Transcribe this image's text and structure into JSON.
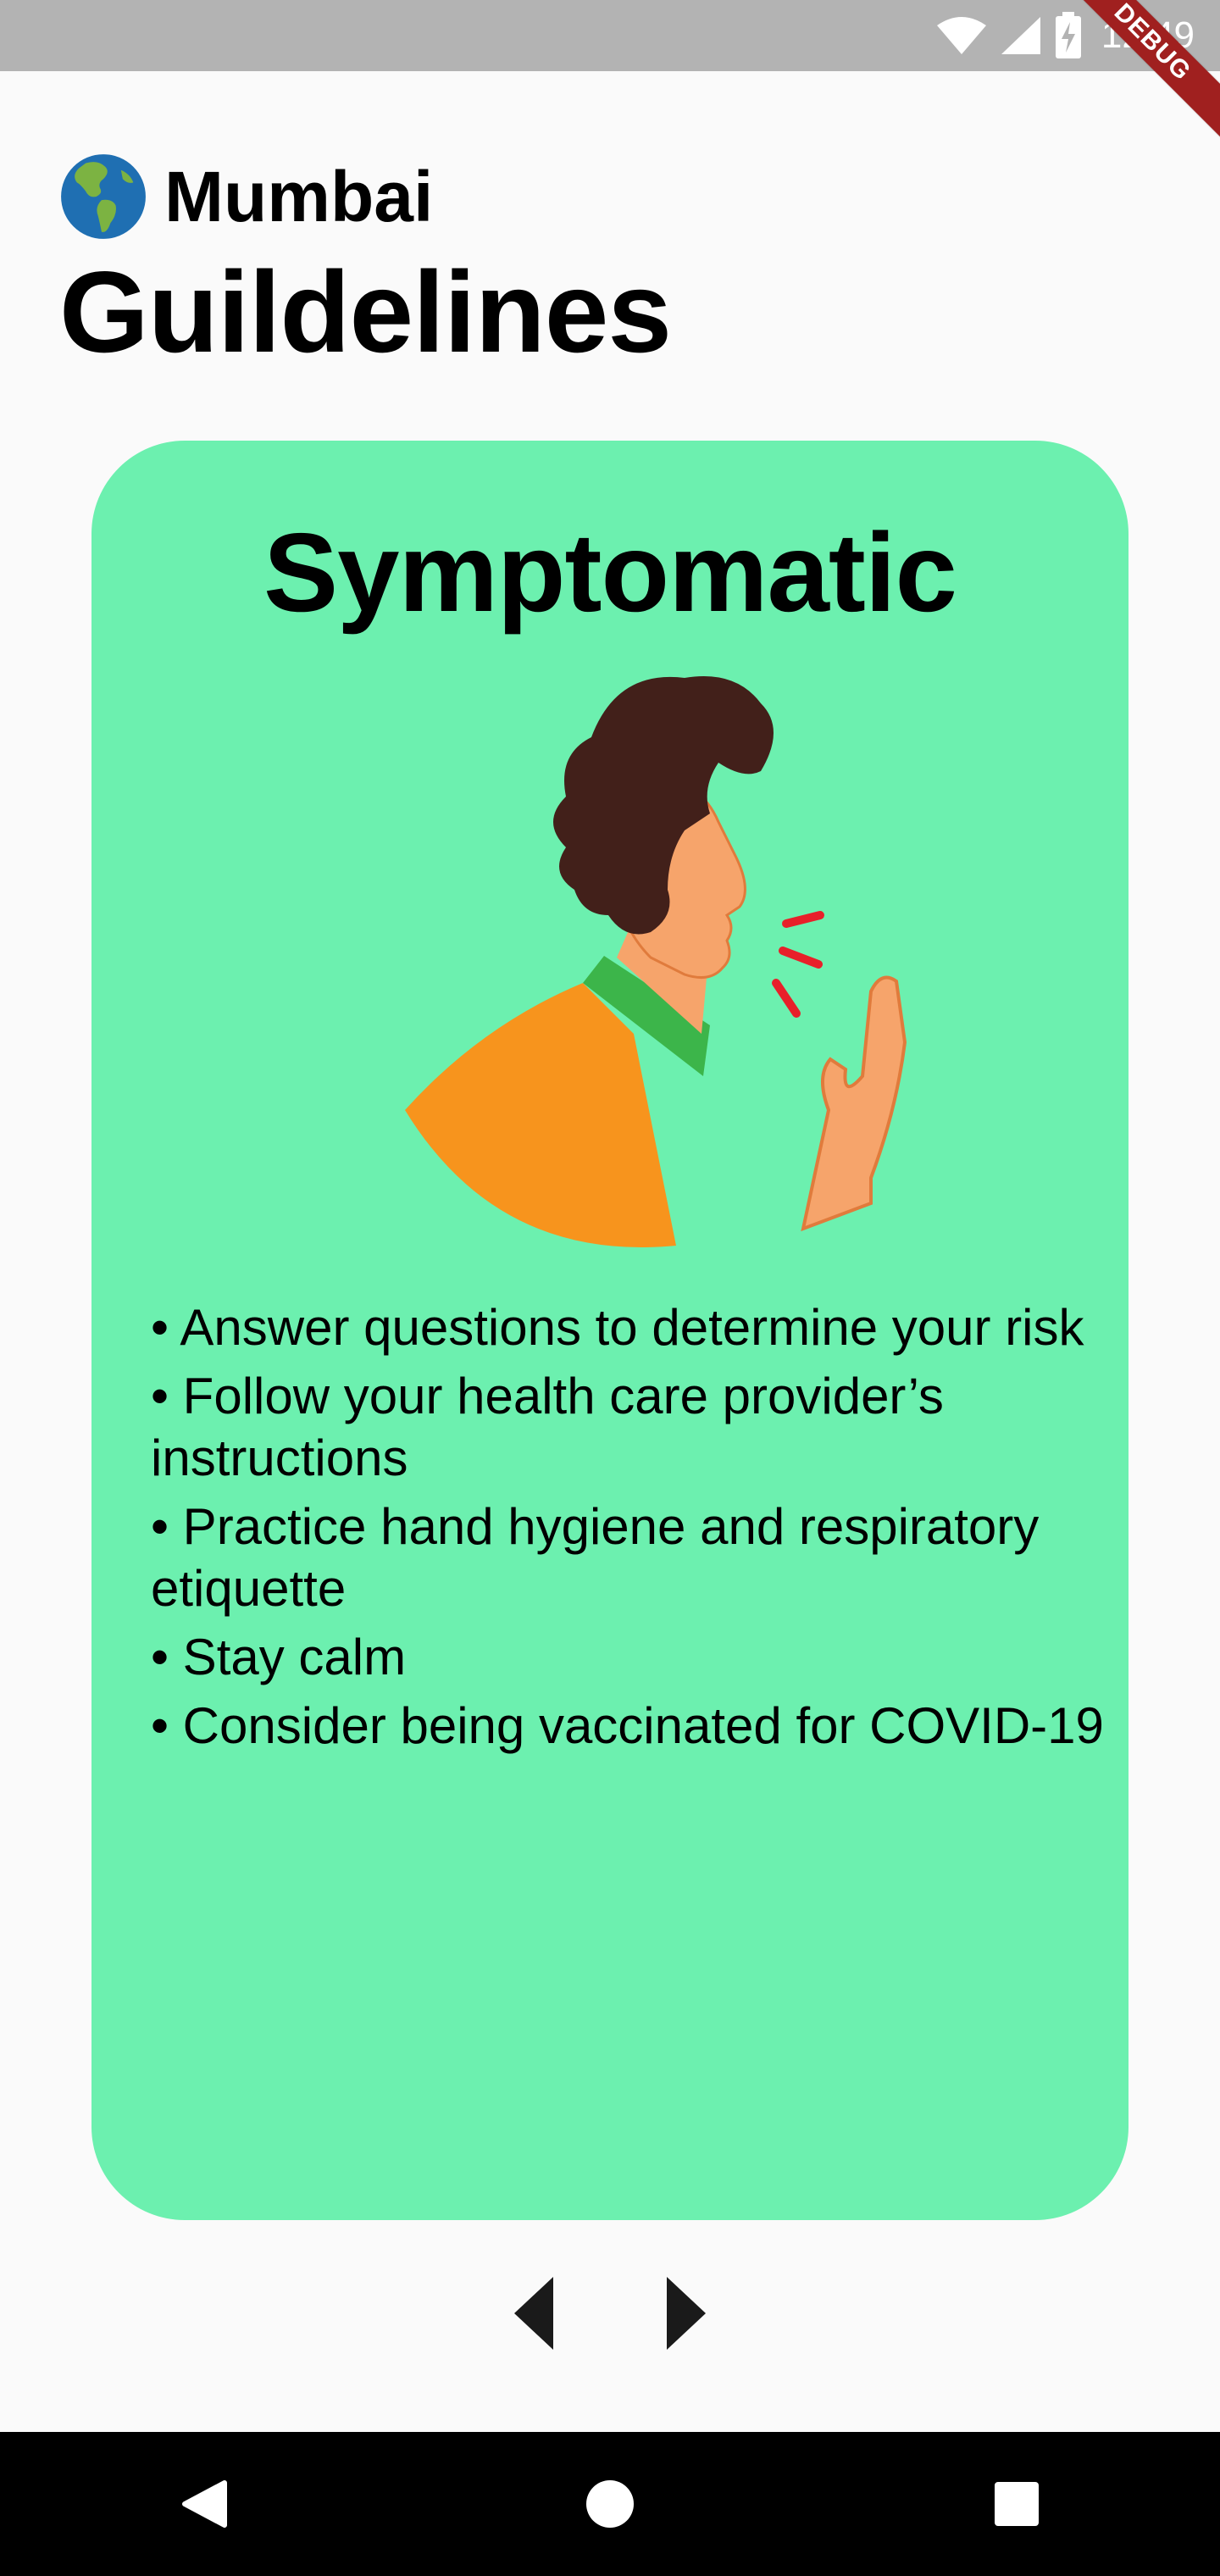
{
  "status_bar": {
    "time": "12:49",
    "icons": [
      "wifi-icon",
      "signal-icon",
      "battery-charging-icon"
    ],
    "debug_label": "DEBUG",
    "background": "#b3b3b3"
  },
  "header": {
    "city_icon": "globe-americas-icon",
    "city": "Mumbai",
    "title": "Guildelines"
  },
  "card": {
    "title": "Symptomatic",
    "background": "#6cf0af",
    "illustration": "person-coughing-illustration",
    "bullets": [
      "• Answer questions to determine your risk",
      "• Follow your health care provider’s instructions",
      "• Practice hand hygiene and respiratory etiquette",
      "• Stay calm",
      "• Consider being vaccinated for COVID-19"
    ]
  },
  "pager": {
    "prev_icon": "arrow-left-icon",
    "next_icon": "arrow-right-icon"
  },
  "nav_bar": {
    "icons": [
      "back-icon",
      "home-icon",
      "recents-icon"
    ]
  }
}
